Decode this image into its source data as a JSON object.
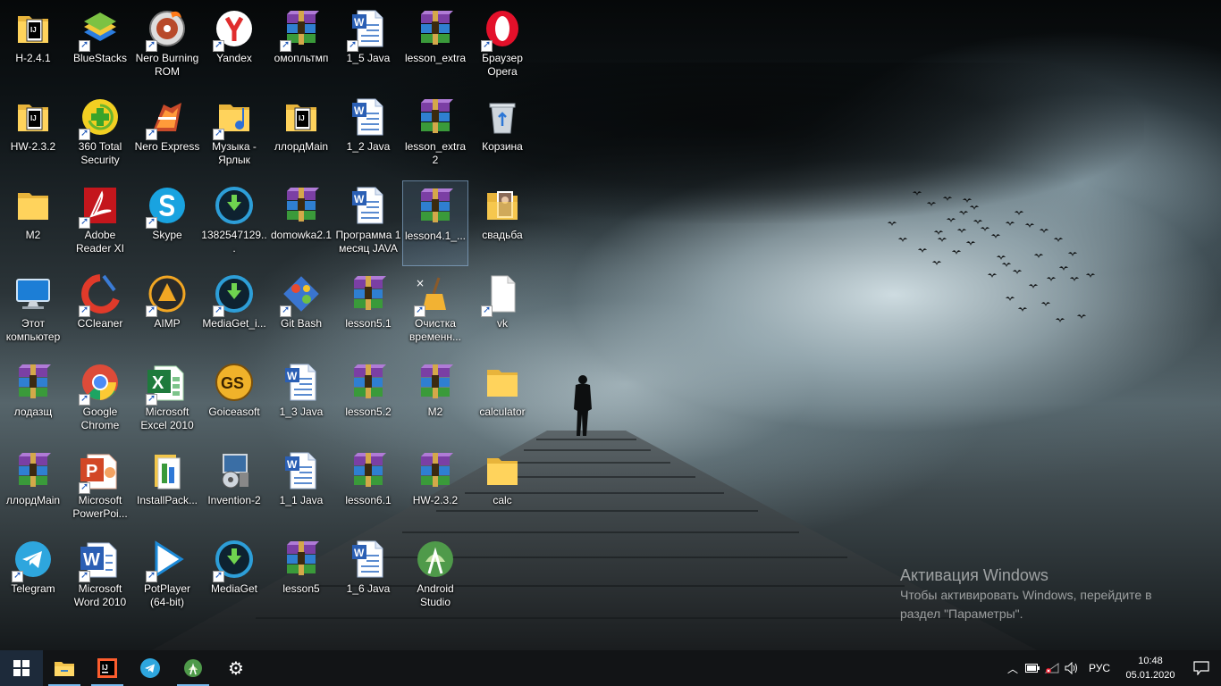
{
  "desktop": {
    "icons": [
      {
        "label": "H-2.4.1",
        "icon": "folder-intellij-icon",
        "shortcut": false
      },
      {
        "label": "BlueStacks",
        "icon": "bluestacks-icon",
        "shortcut": true
      },
      {
        "label": "Nero Burning ROM",
        "icon": "nero-burning-rom-icon",
        "shortcut": true
      },
      {
        "label": "Yandex",
        "icon": "yandex-browser-icon",
        "shortcut": true
      },
      {
        "label": "омопльтмп",
        "icon": "winrar-archive-icon",
        "shortcut": true
      },
      {
        "label": "1_5 Java",
        "icon": "word-document-icon",
        "shortcut": true
      },
      {
        "label": "lesson_extra",
        "icon": "winrar-archive-icon",
        "shortcut": false
      },
      {
        "label": "Браузер Opera",
        "icon": "opera-browser-icon",
        "shortcut": true
      },
      {
        "label": "HW-2.3.2",
        "icon": "folder-intellij-icon",
        "shortcut": false
      },
      {
        "label": "360 Total Security",
        "icon": "total-security-icon",
        "shortcut": true
      },
      {
        "label": "Nero Express",
        "icon": "nero-express-icon",
        "shortcut": true
      },
      {
        "label": "Музыка - Ярлык",
        "icon": "music-folder-icon",
        "shortcut": true
      },
      {
        "label": "ллордMain",
        "icon": "folder-intellij-icon",
        "shortcut": false
      },
      {
        "label": "1_2 Java",
        "icon": "word-document-icon",
        "shortcut": false
      },
      {
        "label": "lesson_extra2",
        "icon": "winrar-archive-icon",
        "shortcut": false
      },
      {
        "label": "Корзина",
        "icon": "recycle-bin-icon",
        "shortcut": false
      },
      {
        "label": "M2",
        "icon": "folder-icon",
        "shortcut": false
      },
      {
        "label": "Adobe Reader XI",
        "icon": "adobe-reader-icon",
        "shortcut": true
      },
      {
        "label": "Skype",
        "icon": "skype-icon",
        "shortcut": true
      },
      {
        "label": "1382547129...",
        "icon": "mediaget-icon",
        "shortcut": false
      },
      {
        "label": "domowka2.1",
        "icon": "winrar-archive-icon",
        "shortcut": false
      },
      {
        "label": "Программа 1 месяц JAVA",
        "icon": "word-document-icon",
        "shortcut": false
      },
      {
        "label": "lesson4.1_...",
        "icon": "winrar-archive-icon",
        "shortcut": false
      },
      {
        "label": "свадьба",
        "icon": "photo-folder-icon",
        "shortcut": false
      },
      {
        "label": "Этот компьютер",
        "icon": "this-pc-icon",
        "shortcut": false
      },
      {
        "label": "CCleaner",
        "icon": "ccleaner-icon",
        "shortcut": true
      },
      {
        "label": "AIMP",
        "icon": "aimp-icon",
        "shortcut": true
      },
      {
        "label": "MediaGet_i...",
        "icon": "mediaget-icon",
        "shortcut": true
      },
      {
        "label": "Git Bash",
        "icon": "git-bash-icon",
        "shortcut": true
      },
      {
        "label": "lesson5.1",
        "icon": "winrar-archive-icon",
        "shortcut": false
      },
      {
        "label": "Очистка временн...",
        "icon": "cleanup-icon",
        "shortcut": true
      },
      {
        "label": "vk",
        "icon": "blank-file-icon",
        "shortcut": true
      },
      {
        "label": "лодазщ",
        "icon": "winrar-archive-icon",
        "shortcut": false
      },
      {
        "label": "Google Chrome",
        "icon": "chrome-icon",
        "shortcut": true
      },
      {
        "label": "Microsoft Excel 2010",
        "icon": "excel-icon",
        "shortcut": true
      },
      {
        "label": "Goiceasoft",
        "icon": "goiceasoft-icon",
        "shortcut": false
      },
      {
        "label": "1_3 Java",
        "icon": "word-document-icon",
        "shortcut": false
      },
      {
        "label": "lesson5.2",
        "icon": "winrar-archive-icon",
        "shortcut": false
      },
      {
        "label": "M2",
        "icon": "winrar-archive-icon",
        "shortcut": false
      },
      {
        "label": "calculator",
        "icon": "folder-icon",
        "shortcut": false
      },
      {
        "label": "ллордMain",
        "icon": "winrar-archive-icon",
        "shortcut": false
      },
      {
        "label": "Microsoft PowerPoi...",
        "icon": "powerpoint-icon",
        "shortcut": true
      },
      {
        "label": "InstallPack...",
        "icon": "installpack-icon",
        "shortcut": false
      },
      {
        "label": "Invention-2",
        "icon": "installer-icon",
        "shortcut": false
      },
      {
        "label": "1_1 Java",
        "icon": "word-document-icon",
        "shortcut": false
      },
      {
        "label": "lesson6.1",
        "icon": "winrar-archive-icon",
        "shortcut": false
      },
      {
        "label": "HW-2.3.2",
        "icon": "winrar-archive-icon",
        "shortcut": false
      },
      {
        "label": "calc",
        "icon": "folder-icon",
        "shortcut": false
      },
      {
        "label": "Telegram",
        "icon": "telegram-icon",
        "shortcut": true
      },
      {
        "label": "Microsoft Word 2010",
        "icon": "word-app-icon",
        "shortcut": true
      },
      {
        "label": "PotPlayer (64-bit)",
        "icon": "potplayer-icon",
        "shortcut": true
      },
      {
        "label": "MediaGet",
        "icon": "mediaget-icon",
        "shortcut": true
      },
      {
        "label": "lesson5",
        "icon": "winrar-archive-icon",
        "shortcut": false
      },
      {
        "label": "1_6 Java",
        "icon": "word-document-icon",
        "shortcut": false
      },
      {
        "label": "Android Studio",
        "icon": "android-studio-icon",
        "shortcut": false
      }
    ],
    "selected_index": 22
  },
  "activation": {
    "title": "Активация Windows",
    "message": "Чтобы активировать Windows, перейдите в раздел \"Параметры\"."
  },
  "taskbar": {
    "pinned": [
      {
        "name": "file-explorer",
        "icon": "file-explorer-icon"
      },
      {
        "name": "intellij-idea",
        "icon": "intellij-icon"
      },
      {
        "name": "telegram",
        "icon": "telegram-icon"
      },
      {
        "name": "android-studio",
        "icon": "android-studio-icon"
      },
      {
        "name": "settings",
        "icon": "gear-icon"
      }
    ],
    "tray": {
      "language": "РУС",
      "time": "10:48",
      "date": "05.01.2020"
    }
  }
}
